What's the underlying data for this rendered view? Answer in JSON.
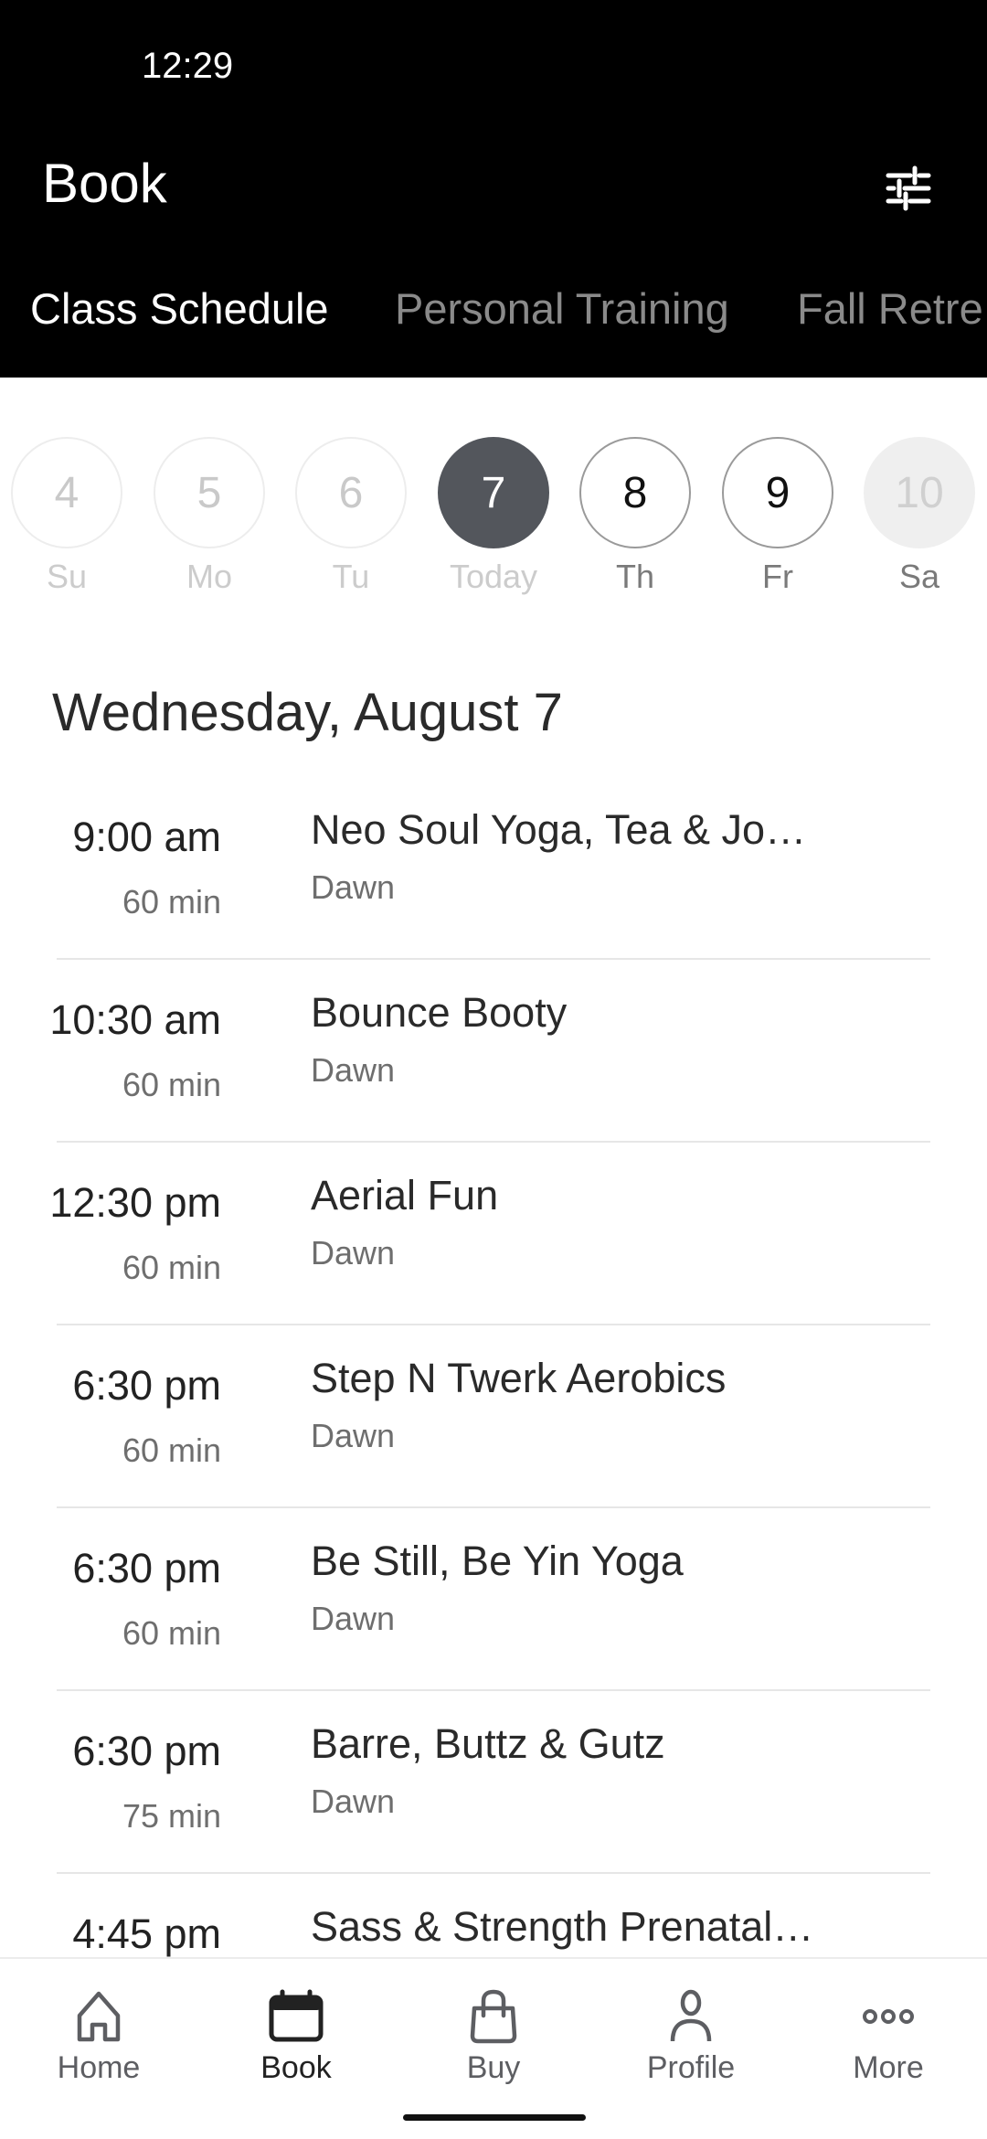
{
  "status_bar": {
    "time": "12:29"
  },
  "header": {
    "title": "Book",
    "filter_icon": "sliders-icon"
  },
  "tabs": [
    {
      "label": "Class Schedule",
      "active": true
    },
    {
      "label": "Personal Training",
      "active": false
    },
    {
      "label": "Fall Retre",
      "active": false
    }
  ],
  "days": [
    {
      "number": "4",
      "label": "Su",
      "state": "past"
    },
    {
      "number": "5",
      "label": "Mo",
      "state": "past"
    },
    {
      "number": "6",
      "label": "Tu",
      "state": "past"
    },
    {
      "number": "7",
      "label": "Today",
      "state": "selected"
    },
    {
      "number": "8",
      "label": "Th",
      "state": "future"
    },
    {
      "number": "9",
      "label": "Fr",
      "state": "future"
    },
    {
      "number": "10",
      "label": "Sa",
      "state": "unavailable"
    }
  ],
  "date_heading": "Wednesday, August 7",
  "classes": [
    {
      "time": "9:00 am",
      "duration": "60 min",
      "name": "Neo Soul Yoga, Tea & Jo…",
      "instructor": "Dawn"
    },
    {
      "time": "10:30 am",
      "duration": "60 min",
      "name": "Bounce Booty",
      "instructor": "Dawn"
    },
    {
      "time": "12:30 pm",
      "duration": "60 min",
      "name": "Aerial Fun",
      "instructor": "Dawn"
    },
    {
      "time": "6:30 pm",
      "duration": "60 min",
      "name": "Step N Twerk Aerobics",
      "instructor": "Dawn"
    },
    {
      "time": "6:30 pm",
      "duration": "60 min",
      "name": "Be Still, Be Yin Yoga",
      "instructor": "Dawn"
    },
    {
      "time": "6:30 pm",
      "duration": "75 min",
      "name": "Barre, Buttz & Gutz",
      "instructor": "Dawn"
    },
    {
      "time": "4:45 pm",
      "duration": "",
      "name": "Sass & Strength Prenatal…",
      "instructor": ""
    }
  ],
  "bottom_nav": [
    {
      "label": "Home",
      "icon": "home-icon",
      "active": false
    },
    {
      "label": "Book",
      "icon": "calendar-icon",
      "active": true
    },
    {
      "label": "Buy",
      "icon": "shopping-bag-icon",
      "active": false
    },
    {
      "label": "Profile",
      "icon": "person-icon",
      "active": false
    },
    {
      "label": "More",
      "icon": "more-dots-icon",
      "active": false
    }
  ],
  "colors": {
    "header_bg": "#000000",
    "selected_day": "#53565c",
    "divider": "#e6e6e6"
  }
}
